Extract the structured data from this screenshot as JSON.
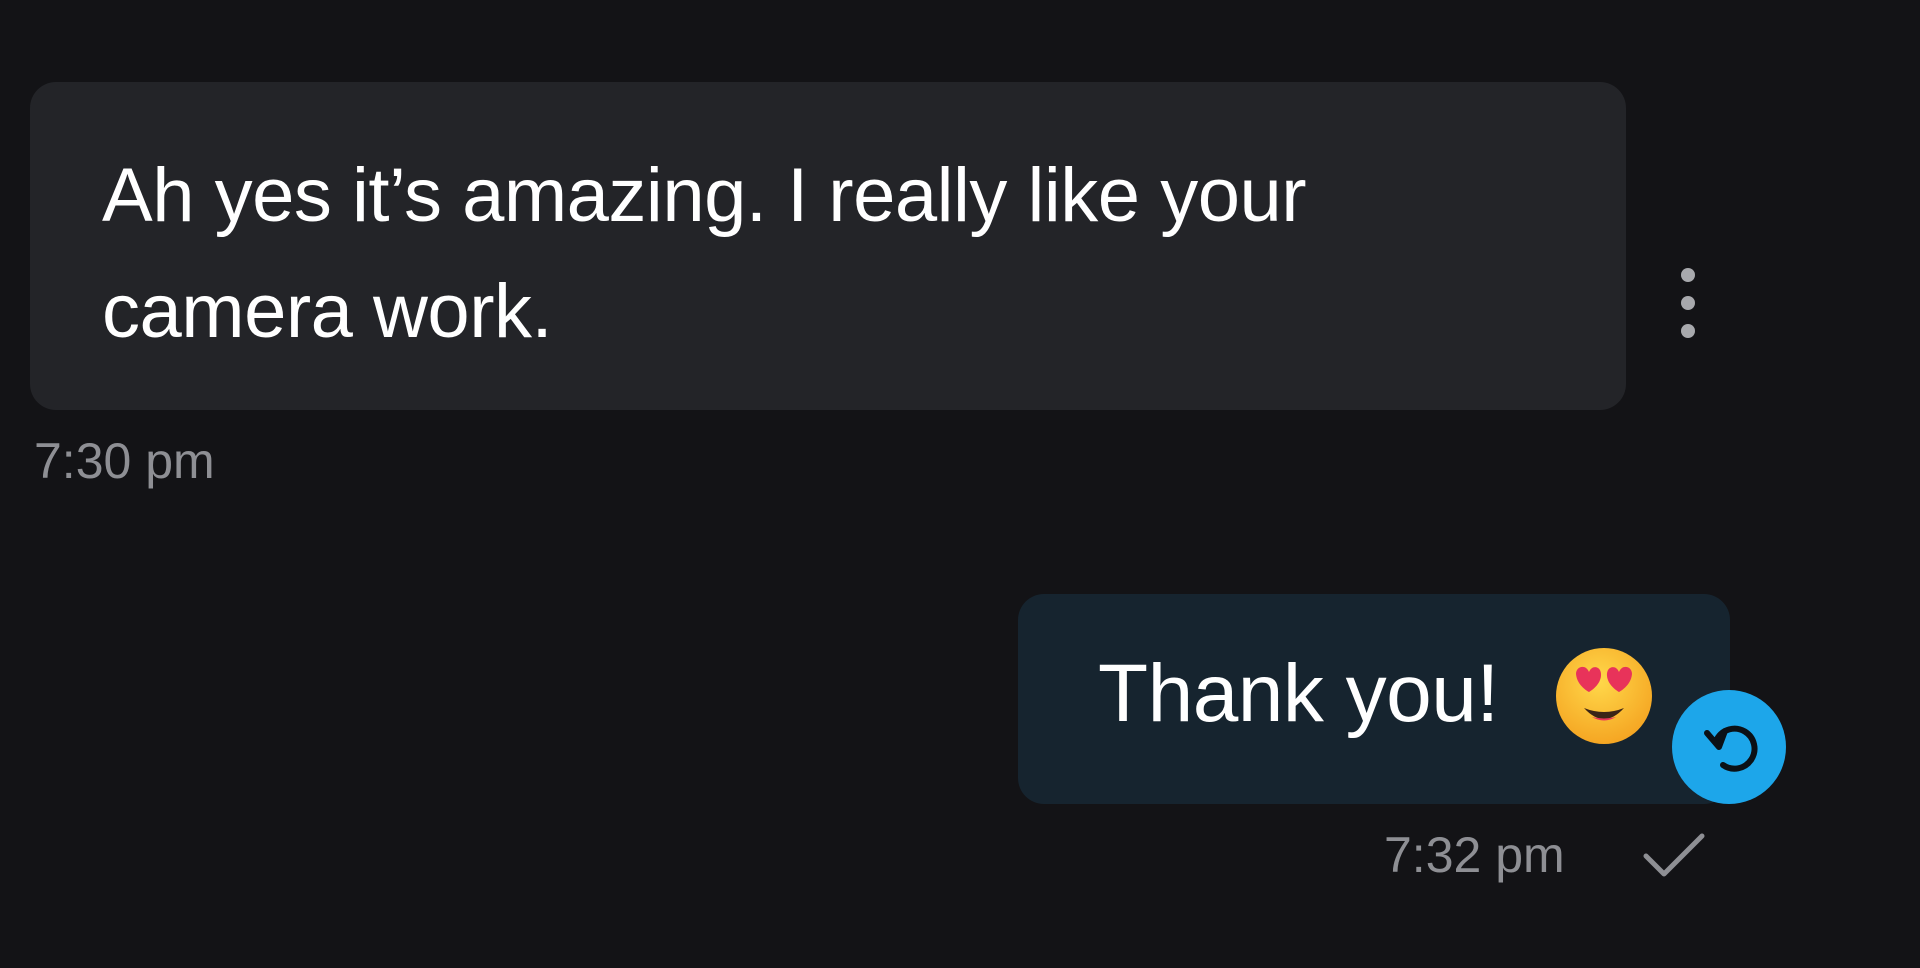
{
  "messages": [
    {
      "direction": "received",
      "text": "Ah yes it’s amazing. I really like your camera work.",
      "time": "7:30 pm"
    },
    {
      "direction": "sent",
      "text": "Thank you!",
      "emoji": "smiling-face-with-heart-eyes",
      "time": "7:32 pm",
      "status_icon": "check-icon"
    }
  ],
  "icons": {
    "more": "more-vertical-icon",
    "reply": "reply-icon"
  },
  "colors": {
    "background": "#131316",
    "received_bubble": "#232428",
    "sent_bubble": "#16242f",
    "reply_button": "#1da6ea",
    "timestamp": "#8e8f94"
  }
}
